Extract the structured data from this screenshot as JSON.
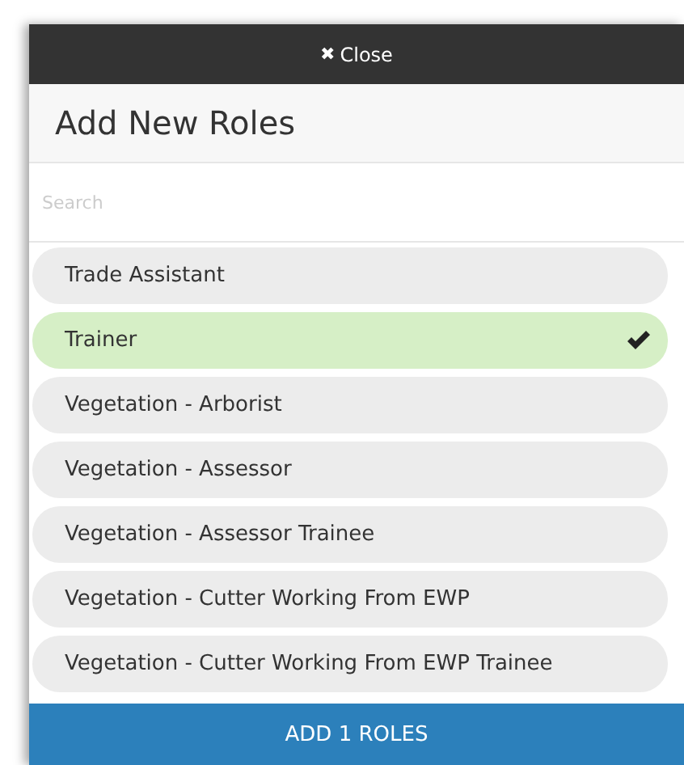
{
  "close_bar": {
    "icon": "✖",
    "label": "Close"
  },
  "title": "Add New Roles",
  "search": {
    "placeholder": "Search"
  },
  "roles": [
    {
      "label": "Trade Assistant",
      "selected": false
    },
    {
      "label": "Trainer",
      "selected": true
    },
    {
      "label": "Vegetation - Arborist",
      "selected": false
    },
    {
      "label": "Vegetation - Assessor",
      "selected": false
    },
    {
      "label": "Vegetation - Assessor Trainee",
      "selected": false
    },
    {
      "label": "Vegetation - Cutter Working From EWP",
      "selected": false
    },
    {
      "label": "Vegetation - Cutter Working From EWP Trainee",
      "selected": false
    }
  ],
  "add_button": "ADD 1 ROLES"
}
